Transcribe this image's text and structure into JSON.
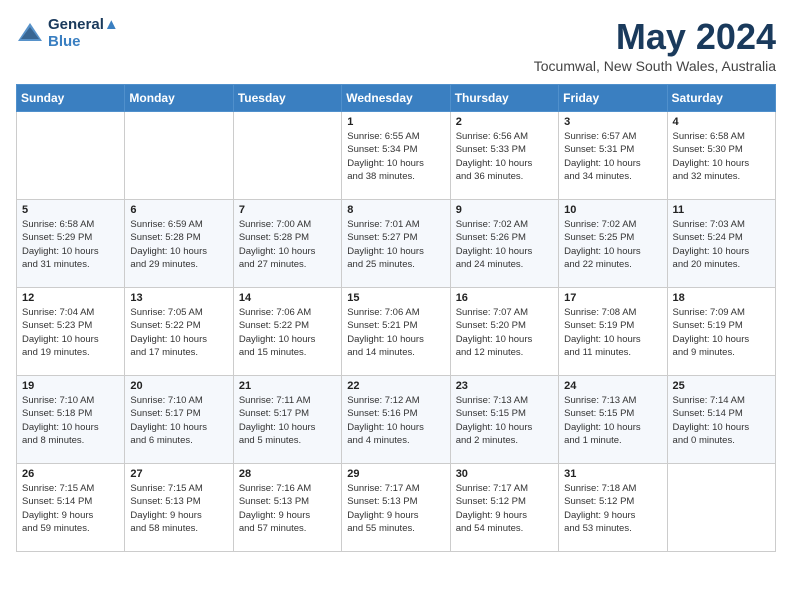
{
  "header": {
    "logo_line1": "General",
    "logo_line2": "Blue",
    "month": "May 2024",
    "location": "Tocumwal, New South Wales, Australia"
  },
  "weekdays": [
    "Sunday",
    "Monday",
    "Tuesday",
    "Wednesday",
    "Thursday",
    "Friday",
    "Saturday"
  ],
  "weeks": [
    [
      {
        "day": "",
        "info": ""
      },
      {
        "day": "",
        "info": ""
      },
      {
        "day": "",
        "info": ""
      },
      {
        "day": "1",
        "info": "Sunrise: 6:55 AM\nSunset: 5:34 PM\nDaylight: 10 hours\nand 38 minutes."
      },
      {
        "day": "2",
        "info": "Sunrise: 6:56 AM\nSunset: 5:33 PM\nDaylight: 10 hours\nand 36 minutes."
      },
      {
        "day": "3",
        "info": "Sunrise: 6:57 AM\nSunset: 5:31 PM\nDaylight: 10 hours\nand 34 minutes."
      },
      {
        "day": "4",
        "info": "Sunrise: 6:58 AM\nSunset: 5:30 PM\nDaylight: 10 hours\nand 32 minutes."
      }
    ],
    [
      {
        "day": "5",
        "info": "Sunrise: 6:58 AM\nSunset: 5:29 PM\nDaylight: 10 hours\nand 31 minutes."
      },
      {
        "day": "6",
        "info": "Sunrise: 6:59 AM\nSunset: 5:28 PM\nDaylight: 10 hours\nand 29 minutes."
      },
      {
        "day": "7",
        "info": "Sunrise: 7:00 AM\nSunset: 5:28 PM\nDaylight: 10 hours\nand 27 minutes."
      },
      {
        "day": "8",
        "info": "Sunrise: 7:01 AM\nSunset: 5:27 PM\nDaylight: 10 hours\nand 25 minutes."
      },
      {
        "day": "9",
        "info": "Sunrise: 7:02 AM\nSunset: 5:26 PM\nDaylight: 10 hours\nand 24 minutes."
      },
      {
        "day": "10",
        "info": "Sunrise: 7:02 AM\nSunset: 5:25 PM\nDaylight: 10 hours\nand 22 minutes."
      },
      {
        "day": "11",
        "info": "Sunrise: 7:03 AM\nSunset: 5:24 PM\nDaylight: 10 hours\nand 20 minutes."
      }
    ],
    [
      {
        "day": "12",
        "info": "Sunrise: 7:04 AM\nSunset: 5:23 PM\nDaylight: 10 hours\nand 19 minutes."
      },
      {
        "day": "13",
        "info": "Sunrise: 7:05 AM\nSunset: 5:22 PM\nDaylight: 10 hours\nand 17 minutes."
      },
      {
        "day": "14",
        "info": "Sunrise: 7:06 AM\nSunset: 5:22 PM\nDaylight: 10 hours\nand 15 minutes."
      },
      {
        "day": "15",
        "info": "Sunrise: 7:06 AM\nSunset: 5:21 PM\nDaylight: 10 hours\nand 14 minutes."
      },
      {
        "day": "16",
        "info": "Sunrise: 7:07 AM\nSunset: 5:20 PM\nDaylight: 10 hours\nand 12 minutes."
      },
      {
        "day": "17",
        "info": "Sunrise: 7:08 AM\nSunset: 5:19 PM\nDaylight: 10 hours\nand 11 minutes."
      },
      {
        "day": "18",
        "info": "Sunrise: 7:09 AM\nSunset: 5:19 PM\nDaylight: 10 hours\nand 9 minutes."
      }
    ],
    [
      {
        "day": "19",
        "info": "Sunrise: 7:10 AM\nSunset: 5:18 PM\nDaylight: 10 hours\nand 8 minutes."
      },
      {
        "day": "20",
        "info": "Sunrise: 7:10 AM\nSunset: 5:17 PM\nDaylight: 10 hours\nand 6 minutes."
      },
      {
        "day": "21",
        "info": "Sunrise: 7:11 AM\nSunset: 5:17 PM\nDaylight: 10 hours\nand 5 minutes."
      },
      {
        "day": "22",
        "info": "Sunrise: 7:12 AM\nSunset: 5:16 PM\nDaylight: 10 hours\nand 4 minutes."
      },
      {
        "day": "23",
        "info": "Sunrise: 7:13 AM\nSunset: 5:15 PM\nDaylight: 10 hours\nand 2 minutes."
      },
      {
        "day": "24",
        "info": "Sunrise: 7:13 AM\nSunset: 5:15 PM\nDaylight: 10 hours\nand 1 minute."
      },
      {
        "day": "25",
        "info": "Sunrise: 7:14 AM\nSunset: 5:14 PM\nDaylight: 10 hours\nand 0 minutes."
      }
    ],
    [
      {
        "day": "26",
        "info": "Sunrise: 7:15 AM\nSunset: 5:14 PM\nDaylight: 9 hours\nand 59 minutes."
      },
      {
        "day": "27",
        "info": "Sunrise: 7:15 AM\nSunset: 5:13 PM\nDaylight: 9 hours\nand 58 minutes."
      },
      {
        "day": "28",
        "info": "Sunrise: 7:16 AM\nSunset: 5:13 PM\nDaylight: 9 hours\nand 57 minutes."
      },
      {
        "day": "29",
        "info": "Sunrise: 7:17 AM\nSunset: 5:13 PM\nDaylight: 9 hours\nand 55 minutes."
      },
      {
        "day": "30",
        "info": "Sunrise: 7:17 AM\nSunset: 5:12 PM\nDaylight: 9 hours\nand 54 minutes."
      },
      {
        "day": "31",
        "info": "Sunrise: 7:18 AM\nSunset: 5:12 PM\nDaylight: 9 hours\nand 53 minutes."
      },
      {
        "day": "",
        "info": ""
      }
    ]
  ]
}
